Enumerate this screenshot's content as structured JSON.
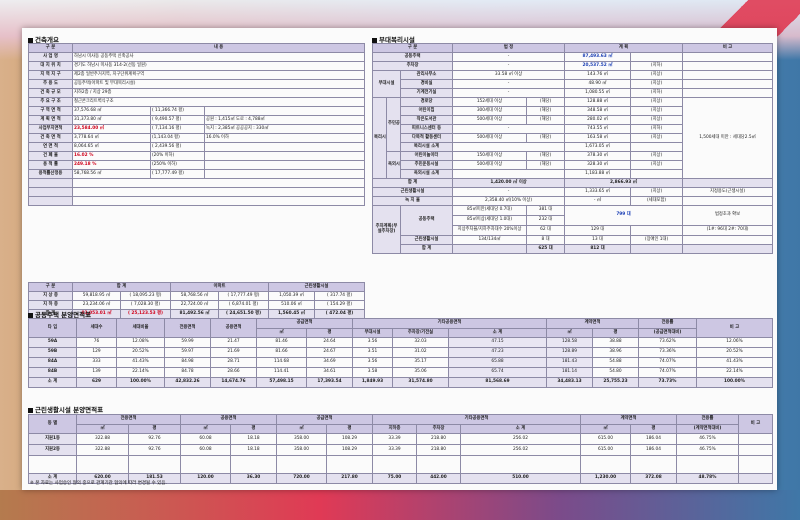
{
  "bldg": {
    "title": "건축개요",
    "head": [
      "구 분",
      "내 용"
    ],
    "rows": [
      [
        "사 업 명",
        "하남시 미사동 공동주택 신축공사",
        "",
        ""
      ],
      [
        "대 지 위 치",
        "경기도 하남시 미사동 314-2(선동 일원)",
        "",
        ""
      ],
      [
        "지 역 지 구",
        "제2종 일반주거지역, 지구단위계획구역",
        "",
        ""
      ],
      [
        "주 용 도",
        "공동주택(아파트 및 부대복리시설)",
        "",
        ""
      ],
      [
        "건 축 규 모",
        "지하2층 / 지상 29층",
        "",
        ""
      ],
      [
        "주 요 구 조",
        "철근콘크리트벽식구조",
        "",
        ""
      ],
      [
        "구 역 면 적",
        "37,576.68 ㎡",
        "( 11,366.74 평)",
        ""
      ],
      [
        "계 획 면 적",
        "31,373.80 ㎡",
        "( 9,490.57 평)",
        "공원 : 1,415㎡  도로 : 4,788㎡"
      ],
      [
        "사업부지면적",
        "23,584.00 ㎡",
        "( 7,134.16 평)",
        "녹지 : 2,385㎡  공공공지 : 330㎡"
      ],
      [
        "건 축 면 적",
        "3,778.64 ㎡",
        "(1,143.04 평)",
        "16.0% 이하"
      ],
      [
        "연 면 적",
        "8,064.65 ㎡",
        "( 2,439.56 평)",
        ""
      ],
      [
        "건 폐 율",
        "16.02 %",
        "(20% 이하)",
        ""
      ],
      [
        "용 적 률",
        "249.18 %",
        "(250% 이하)",
        ""
      ],
      [
        "용적률산정용",
        "58,768.56 ㎡",
        "( 17,777.49 평)",
        ""
      ]
    ],
    "blank": [
      "",
      "",
      "",
      ""
    ],
    "area_head": [
      "구 분",
      "합 계",
      "아파트",
      "근린생활시설"
    ],
    "area_rows": [
      [
        "지 상 층",
        "59,818.95 ㎡",
        "( 18,095.23 평)",
        "58,768.56 ㎡",
        "( 17,777.49 평)",
        "1,050.39 ㎡",
        "( 317.74 평)"
      ],
      [
        "지 하 층",
        "23,234.06 ㎡",
        "( 7,028.30 평)",
        "22,724.00 ㎡",
        "( 6,874.01 평)",
        "510.06 ㎡",
        "( 154.29 평)"
      ],
      [
        "합 계",
        "83,053.01 ㎡",
        "( 25,123.53 평)",
        "81,492.56 ㎡",
        "( 24,651.50 평)",
        "1,560.45 ㎡",
        "( 472.04 평)"
      ]
    ]
  },
  "amen": {
    "title": "부대복리시설",
    "head": [
      "구 분",
      "법 정",
      "계 획",
      "비 고"
    ],
    "rows": [
      {
        "g": "공동주택",
        "n": "",
        "law": "-",
        "plan": "87,493.63 ㎡",
        "plan2": "",
        "note": ""
      },
      {
        "g": "주차장",
        "n": "",
        "law": "-",
        "plan": "20,537.52 ㎡",
        "plan2": "(지하)",
        "note": ""
      },
      {
        "g": "관리사무소",
        "n": "부대시설",
        "law": "33.58 ㎡ 이상",
        "plan": "143.76 ㎡",
        "plan2": "(지상)",
        "note": ""
      },
      {
        "g": "경비실",
        "n": "",
        "law": "-",
        "plan": "48.90 ㎡",
        "plan2": "(지상)",
        "note": ""
      },
      {
        "g": "기계전기실",
        "n": "",
        "law": "-",
        "plan": "1,080.55 ㎡",
        "plan2": "(지하)",
        "note": ""
      },
      {
        "g": "경로당",
        "n": "",
        "law": "152세대 이상",
        "law2": "(해당)",
        "plan": "128.88 ㎡",
        "plan2": "(지상)",
        "note": ""
      },
      {
        "g": "어린이집",
        "n": "",
        "law": "300세대 이상",
        "law2": "(해당)",
        "plan": "348.58 ㎡",
        "plan2": "(지상)",
        "note": ""
      },
      {
        "g": "작은도서관",
        "n": "",
        "law": "500세대 이상",
        "law2": "(해당)",
        "plan": "280.02 ㎡",
        "plan2": "(지상)",
        "note": ""
      },
      {
        "g": "피트니스센터 등",
        "n": "",
        "law": "-",
        "plan": "743.55 ㎡",
        "plan2": "(지하)",
        "note": ""
      },
      {
        "g": "다목적 활동센터",
        "n": "",
        "law": "500세대 이상",
        "law2": "(해당)",
        "plan": "163.58 ㎡",
        "plan2": "(지상)",
        "note": "1,500세대 미만 : 세대당2.5㎡"
      },
      {
        "g": "복리시설 소계",
        "n": "",
        "law": "",
        "plan": "1,673.05 ㎡",
        "plan2": "",
        "note": ""
      },
      {
        "g": "어린이놀이터",
        "n": "",
        "law": "150세대 이상",
        "law2": "(해당)",
        "plan": "378.30 ㎡",
        "plan2": "(지상)",
        "note": ""
      },
      {
        "g": "주민운동시설",
        "n": "",
        "law": "500세대 이상",
        "law2": "(해당)",
        "plan": "328.30 ㎡",
        "plan2": "(지상)",
        "note": ""
      },
      {
        "g": "옥외시설 소계",
        "n": "",
        "law": "",
        "plan": "1,183.88 ㎡",
        "plan2": "",
        "note": ""
      }
    ],
    "sum": {
      "g": "합 계",
      "law": "1,420.00 ㎡ 이상",
      "plan": "2,866.93 ㎡"
    },
    "shop": {
      "g": "근린생활시설",
      "law": "-",
      "plan": "1,333.65 ㎡",
      "plan2": "(지상)",
      "note": "지정용도(근생시설)"
    },
    "green": {
      "g": "녹 지 율",
      "law": "2,358.40 ㎡(10% 이상)",
      "plan": "- ㎡",
      "plan2": "(세대포함)",
      "note": ""
    },
    "park_group": "주차계획(부설주차장)",
    "park": [
      {
        "g": "공동주택",
        "law": "85㎡미만(세대당 0.7대)",
        "cnt": "381 대",
        "plan": "799 대",
        "note": "법정초과 확보"
      },
      {
        "g": "",
        "law": "85㎡이상(세대당 1.0대)",
        "cnt": "232 대",
        "plan": "",
        "note": ""
      },
      {
        "g": "",
        "law": "지상주차율/지하주차대수 20%이상",
        "cnt": "62 대",
        "plan": "129 대",
        "note": "(1#: 96대 2#: 70대)"
      },
      {
        "g": "근린생활시설",
        "law": "134/134㎡",
        "cnt": "8 대",
        "plan": "13 대",
        "plan2": "(장애인 1대)",
        "note": ""
      },
      {
        "g": "합 계",
        "law": "",
        "cnt": "625 대",
        "plan": "812 대",
        "note": ""
      }
    ],
    "side_labels": {
      "bu": "부대시설",
      "bok": "복리시설",
      "jumin": "주민공동시설",
      "ok": "옥외시설"
    }
  },
  "apt": {
    "title": "공동주택 분양면적표",
    "head1": [
      "타 입",
      "세대수",
      "세대비율",
      "전용면적",
      "공용면적",
      "공급면적",
      "",
      "기타공용면적",
      "",
      "",
      "",
      "계약면적",
      "",
      "전용률",
      "비 고"
    ],
    "head2": [
      "㎡",
      "평",
      "부대시설",
      "주차장/기전실",
      "소 계",
      "㎡",
      "평",
      "(공급면적대비)"
    ],
    "rows": [
      [
        "59A",
        "76",
        "12.08%",
        "59.99",
        "21.47",
        "81.46",
        "24.64",
        "3.56",
        "32.03",
        "47.15",
        "128.58",
        "38.88",
        "73.62%",
        "12.06%"
      ],
      [
        "59B",
        "129",
        "20.52%",
        "59.97",
        "21.69",
        "81.66",
        "24.67",
        "3.51",
        "31.02",
        "47.23",
        "128.89",
        "38.96",
        "73.36%",
        "20.52%"
      ],
      [
        "84A",
        "333",
        "41.43%",
        "84.98",
        "28.71",
        "114.68",
        "34.69",
        "3.56",
        "35.17",
        "65.88",
        "181.43",
        "54.88",
        "74.07%",
        "41.43%"
      ],
      [
        "84B",
        "139",
        "22.14%",
        "84.78",
        "28.66",
        "114.41",
        "34.61",
        "3.58",
        "35.06",
        "65.74",
        "181.14",
        "54.80",
        "74.07%",
        "22.14%"
      ]
    ],
    "total": [
      "소 계",
      "629",
      "100.00%",
      "42,832.26",
      "14,674.76",
      "57,498.15",
      "17,393.54",
      "1,849.93",
      "31,574.80",
      "81,568.69",
      "34,483.13",
      "25,755.23",
      "73.73%",
      "100.00%"
    ]
  },
  "shop": {
    "title": "근린생활시설 분양면적표",
    "head1": [
      "동 별",
      "전용면적",
      "",
      "공용면적",
      "",
      "공급면적",
      "",
      "기타공용면적",
      "",
      "",
      "계약면적",
      "",
      "전용률",
      "비 고"
    ],
    "head2": [
      "㎡",
      "평",
      "㎡",
      "평",
      "㎡",
      "평",
      "지하층",
      "주차장",
      "소 계",
      "㎡",
      "평",
      "(계약면적대비)"
    ],
    "rows": [
      [
        "지원1동",
        "322.88",
        "92.76",
        "60.08",
        "18.18",
        "358.00",
        "108.29",
        "33.39",
        "218.80",
        "256.02",
        "615.00",
        "186.04",
        "46.75%"
      ],
      [
        "지원2동",
        "322.88",
        "92.76",
        "60.08",
        "18.18",
        "358.00",
        "108.29",
        "33.39",
        "218.80",
        "256.02",
        "615.00",
        "186.04",
        "46.75%"
      ]
    ],
    "total": [
      "소 계",
      "620.00",
      "181.53",
      "120.00",
      "36.30",
      "720.00",
      "217.80",
      "75.00",
      "442.00",
      "510.00",
      "1,230.00",
      "372.08",
      "48.78%"
    ],
    "note": "※ 본 자료는 사업승인 협의 중으로 관계기관 협의에 따라 변경될 수 있음."
  }
}
